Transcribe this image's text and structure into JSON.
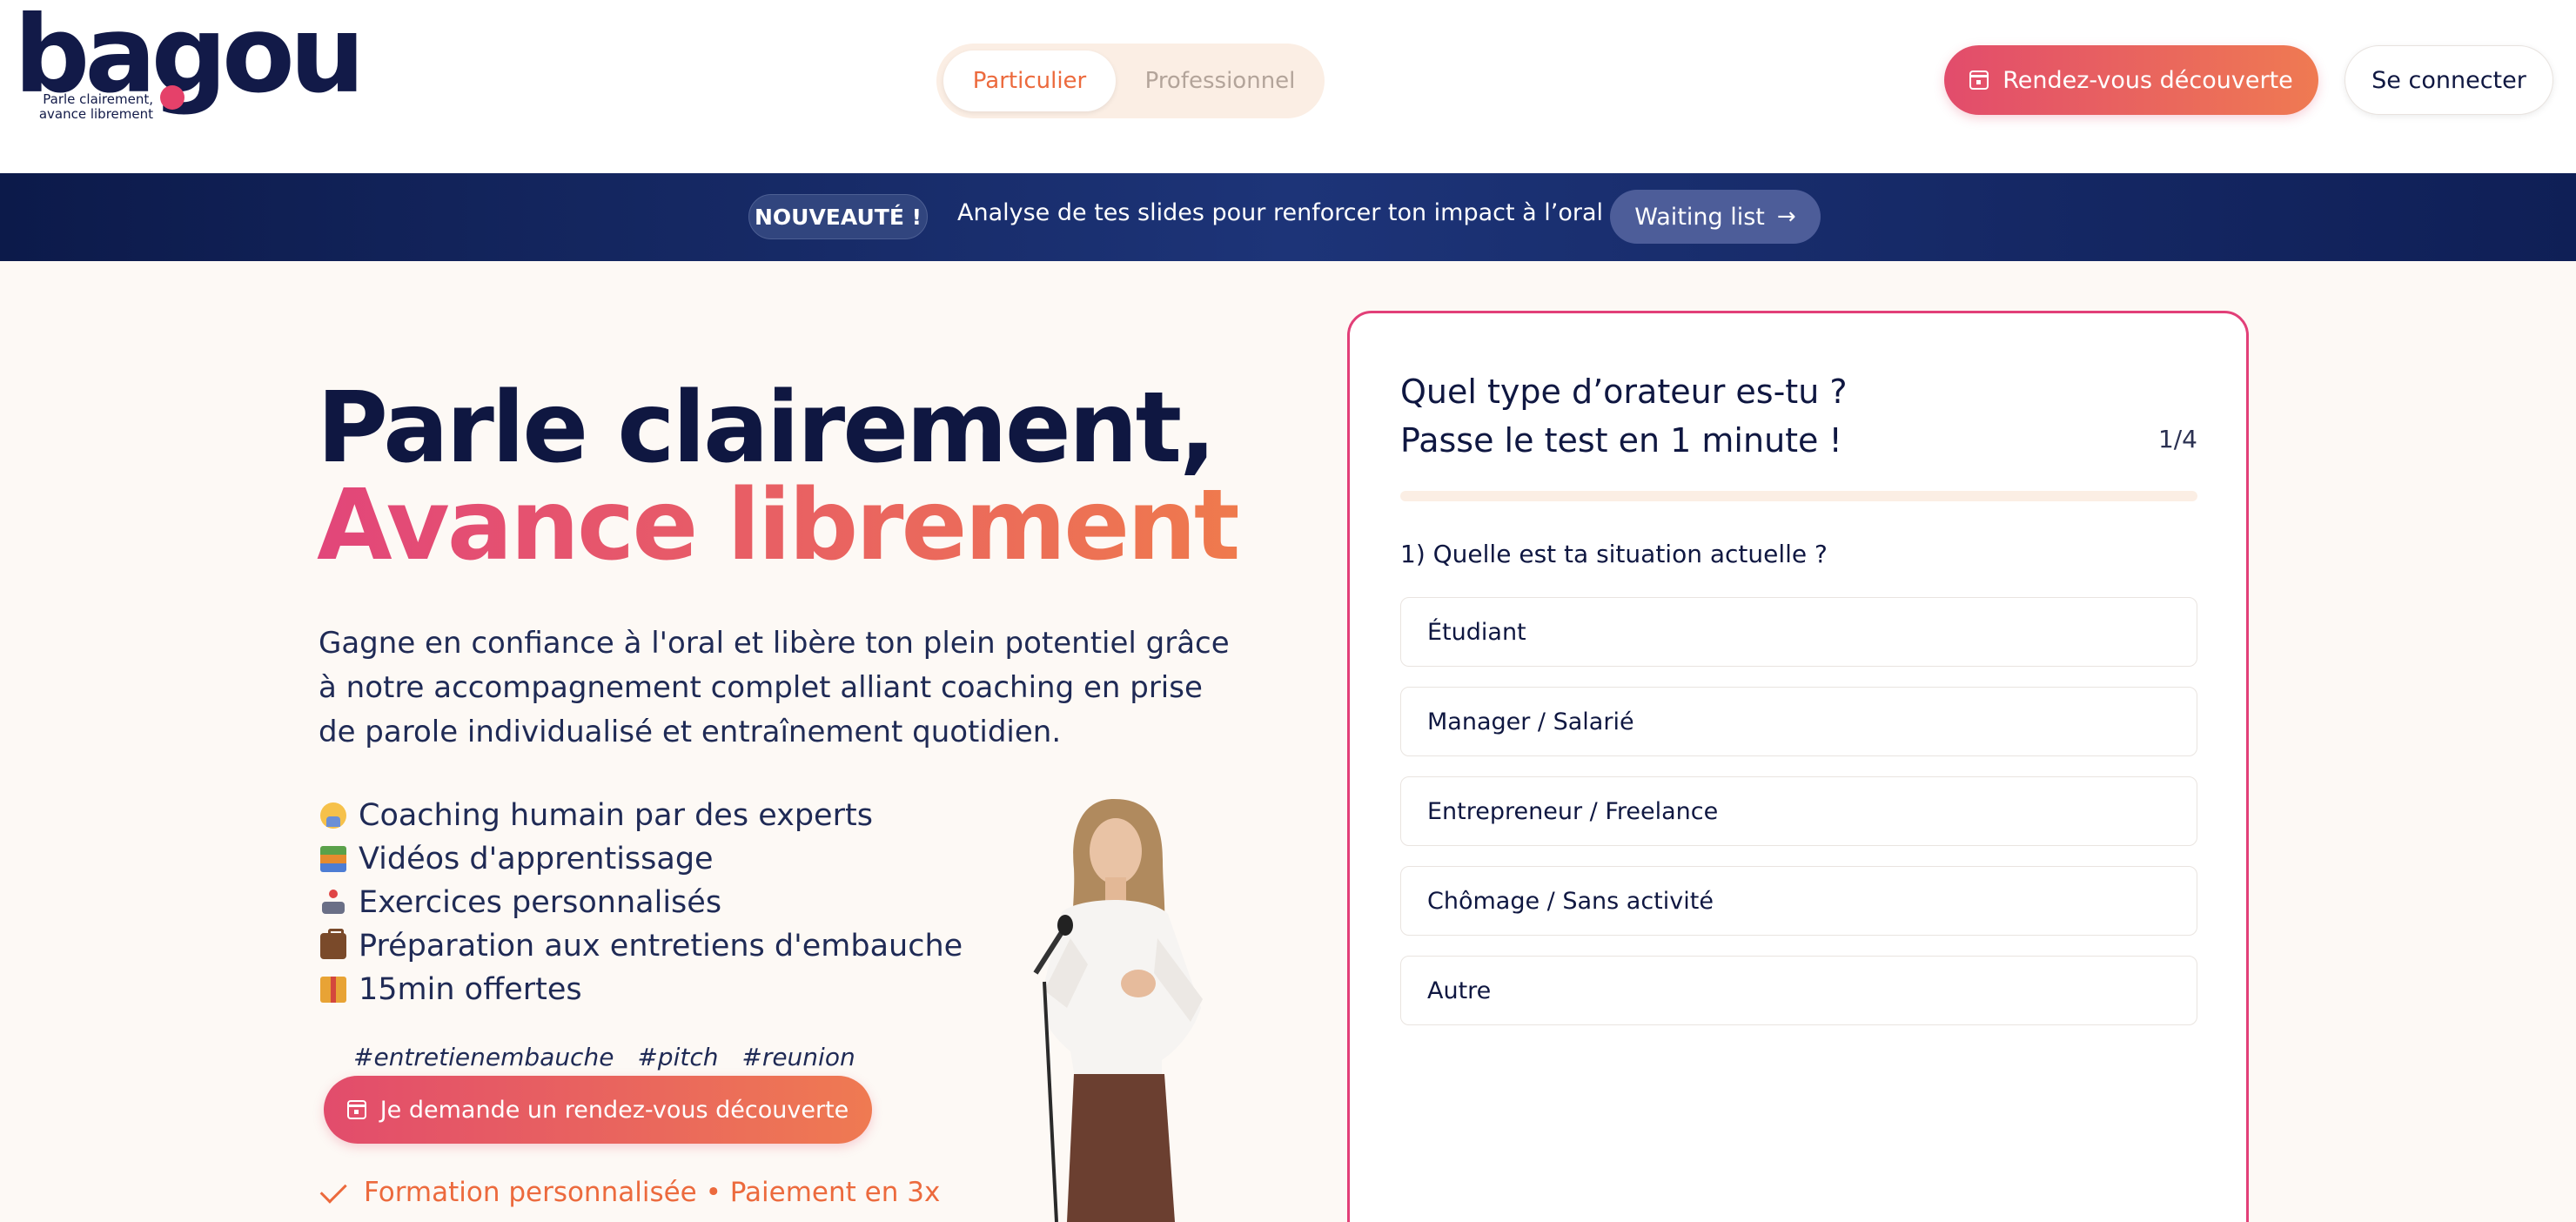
{
  "header": {
    "logo": {
      "wordmark": "bagou",
      "tagline_line1": "Parle clairement,",
      "tagline_line2": "avance librement"
    },
    "segment": {
      "active": "Particulier",
      "inactive": "Professionnel"
    },
    "cta_label": "Rendez-vous découverte",
    "login_label": "Se connecter"
  },
  "banner": {
    "badge": "NOUVEAUTÉ !",
    "text": "Analyse de tes slides pour renforcer ton impact à l’oral !",
    "button_label": "Waiting list"
  },
  "hero": {
    "title_line1": "Parle clairement,",
    "title_line2": "Avance librement",
    "intro": "Gagne en confiance à l'oral et libère ton plein potentiel grâce à notre accompagnement complet alliant coaching en prise de parole individualisé et entraînement quotidien.",
    "features": [
      {
        "icon": "coach-icon",
        "label": "Coaching humain par des experts"
      },
      {
        "icon": "books-icon",
        "label": "Vidéos d'apprentissage"
      },
      {
        "icon": "joystick-icon",
        "label": "Exercices personnalisés"
      },
      {
        "icon": "briefcase-icon",
        "label": "Préparation aux entretiens d'embauche"
      },
      {
        "icon": "gift-icon",
        "label": "15min offertes"
      }
    ],
    "tags": "#entretienembauche #pitch #reunion",
    "cta_label": "Je demande un rendez-vous découverte",
    "reassurance": "Formation personnalisée • Paiement en 3x"
  },
  "quiz": {
    "title_line1": "Quel type d’orateur es-tu ?",
    "title_line2": "Passe le test en 1 minute !",
    "step": "1/4",
    "question": "1) Quelle est ta situation actuelle ?",
    "options": [
      "Étudiant",
      "Manager / Salarié",
      "Entrepreneur / Freelance",
      "Chômage / Sans activité",
      "Autre"
    ]
  },
  "colors": {
    "navy": "#0f1741",
    "accent_pink": "#e24c6c",
    "accent_orange": "#ef7a52",
    "banner_blue": "#1d3478",
    "background": "#fdf9f5"
  }
}
